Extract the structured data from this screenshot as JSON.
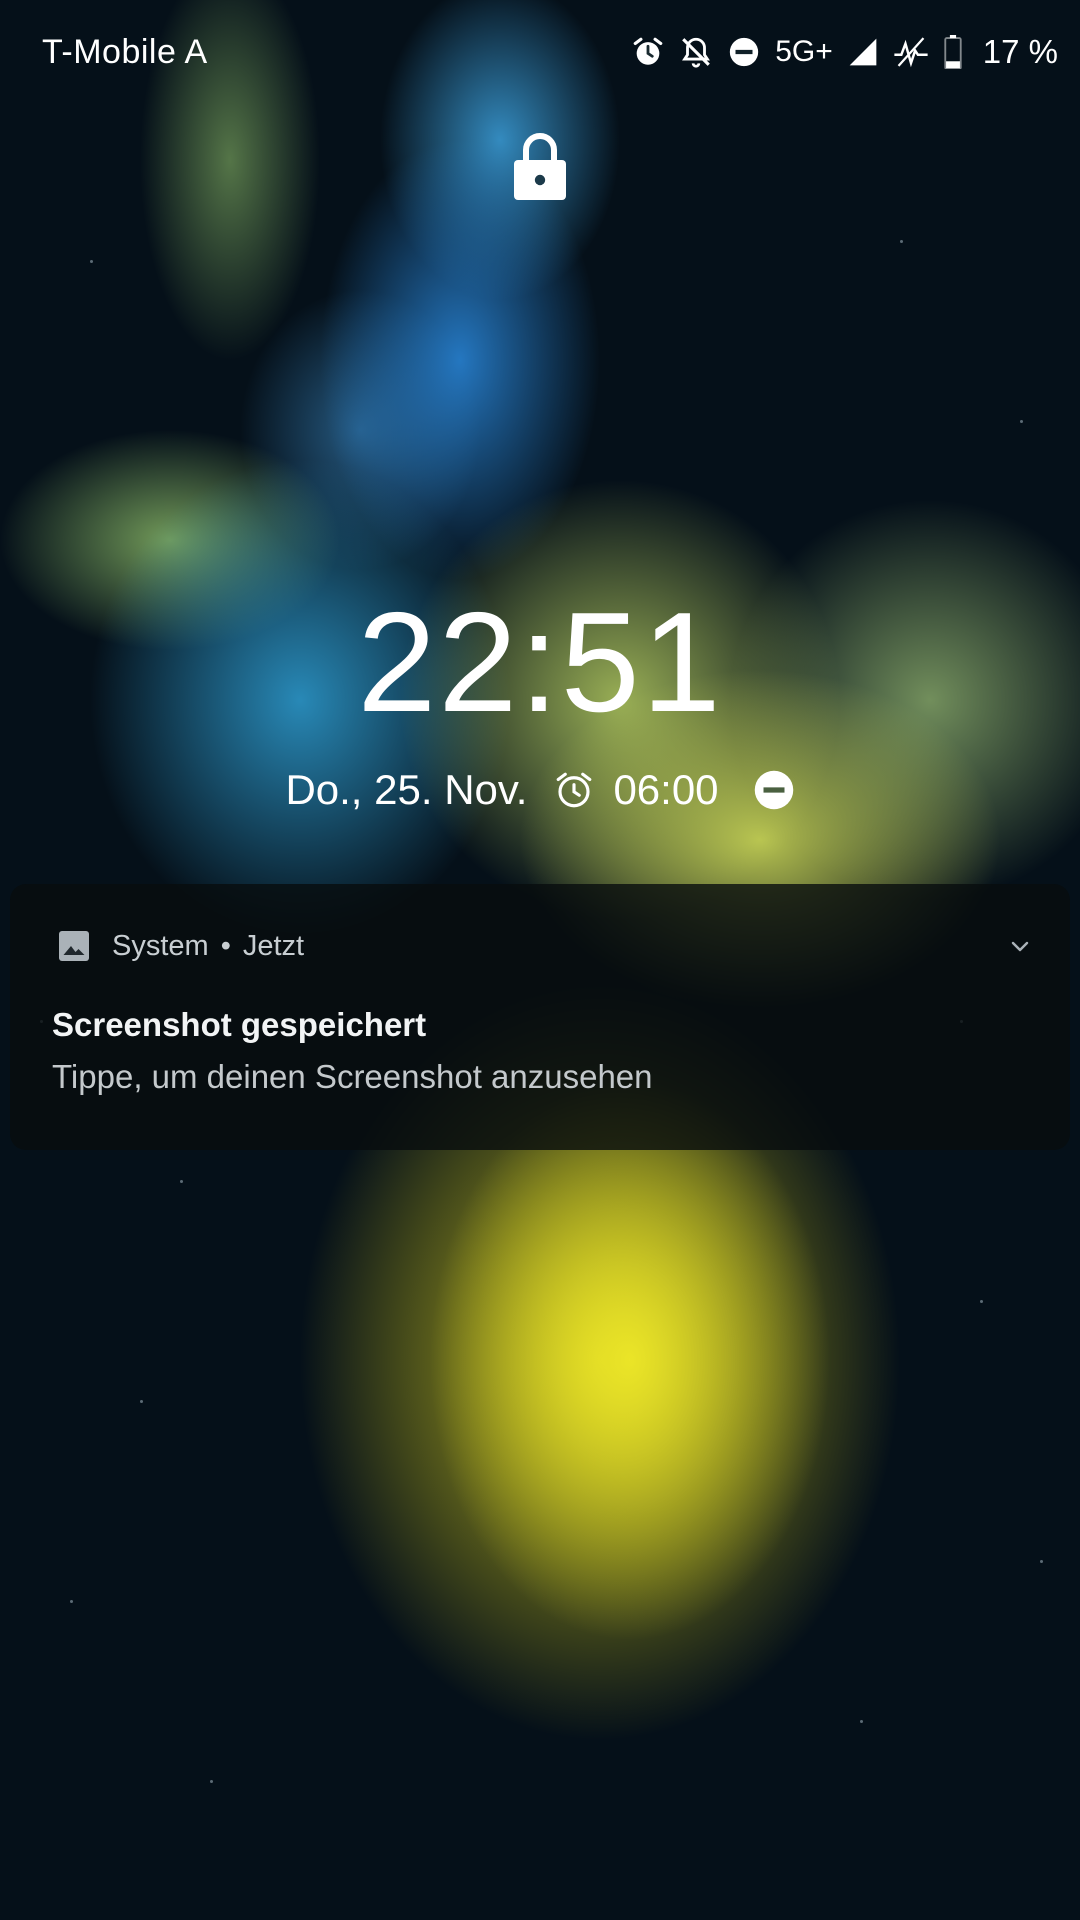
{
  "status_bar": {
    "carrier": "T-Mobile A",
    "network": "5G+",
    "battery": "17 %",
    "icons": [
      "alarm-icon",
      "silent-bell-icon",
      "do-not-disturb-icon",
      "signal-icon",
      "no-sim-signal-icon",
      "battery-icon"
    ]
  },
  "lockscreen": {
    "lock_icon": "lock-icon",
    "time": "22:51",
    "date": "Do., 25. Nov.",
    "alarm_icon": "alarm-icon",
    "alarm_time": "06:00",
    "dnd_icon": "do-not-disturb-icon"
  },
  "notification": {
    "app_icon": "image-icon",
    "app_name": "System",
    "separator": "•",
    "time": "Jetzt",
    "title": "Screenshot gespeichert",
    "text": "Tippe, um deinen Screenshot anzusehen",
    "expand_icon": "chevron-down-icon"
  }
}
